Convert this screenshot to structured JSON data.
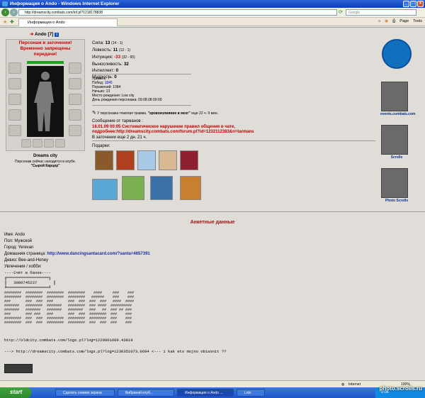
{
  "window": {
    "title": "Информация о Ando - Windows Internet Explorer"
  },
  "browser": {
    "url": "http://dreamscity.combats.com/inf.pl?1218178838",
    "search_placeholder": "Google",
    "tab_label": "Информация о Ando",
    "tools": [
      "Page",
      "Tools"
    ]
  },
  "character": {
    "name": "Ando",
    "level": "[7]",
    "prison_line1": "Персонаж в заточении!",
    "prison_line2": "Временно запрещены",
    "prison_line3": "передачи!",
    "city": "Dreams city",
    "club_text": "Персонаж сейчас находится в клубе.",
    "club_location": "\"Сырой Карцер\""
  },
  "stats": [
    {
      "label": "Сила:",
      "value": "13",
      "extra": "(14 - 1)",
      "neg": false
    },
    {
      "label": "Ловкость:",
      "value": "11",
      "extra": "(12 - 1)",
      "neg": false
    },
    {
      "label": "Интуиция:",
      "value": "-33",
      "extra": "(32 - 65)",
      "neg": true
    },
    {
      "label": "Выносливость:",
      "value": "32",
      "extra": "",
      "neg": false
    },
    {
      "label": "Интеллект:",
      "value": "0",
      "extra": "",
      "neg": false
    },
    {
      "label": "Мудрость:",
      "value": "0",
      "extra": "",
      "neg": false
    }
  ],
  "info": {
    "level_line": "Уровень: 7",
    "wins_label": "Побед: ",
    "wins": "1845",
    "losses": "Поражений: 1084",
    "draws": "Ничьих: 13",
    "birthplace": "Место рождения: Low city",
    "birthday": "День рождения персонажа: 09.08.08 00:00"
  },
  "trauma": {
    "prefix": "У персонажа тяжелая травма. ",
    "name": "\"кровоизлияние в мозг\"",
    "suffix": " еще 22 ч. 9 мин."
  },
  "message": {
    "heading": "Сообщение от тарманов :",
    "line1": "18.01.09 00:05 Систематическое нарушение правил общения в чате,",
    "line2": "подробнее:http://dreamscity.combats.com/forum.pl?id=1232112383&n=tarmans",
    "line3": "В заточении еще 2 дн. 21 ч."
  },
  "gifts": {
    "label": "Подарки:"
  },
  "sidebar": {
    "link1": "events.combats.com",
    "link2": "Scrolls",
    "link3": "Photo Scrolls"
  },
  "anketa": {
    "title": "Анкетные данные",
    "name": "Имя: Ando",
    "sex": "Пол: Мужской",
    "city": "Город: Yerevan",
    "homepage_label": "Домашняя страница: ",
    "homepage": "http://www.dancingsantacard.com/?santa=4657391",
    "motto": "Девиз: Bee-and-Honey",
    "hobby": "Увлечения / хобби:",
    "ascii": "----Счёт в банке----\n╔══════════════════╗\n║   3080745237       ║\n╚══════════════════╝",
    "hashes": "########  ########  ########  ########    ####     ###    ###\n########  ########  ########  ########   ######    ###    ###\n###       ###  ###  ###       ###  ###  ###  ###   ####  ####\n#######   ########  #######   ########  ### ####  ##########\n#######   #######   #######   #######   ###   ##  ### ## ###\n###       ### ###   ###       ###  ###  ########  ###    ###\n########  ###  ###  ########  ########  ########  ###    ###\n########  ###  ###  ########  ########  ###  ###  ###    ###",
    "log1": "http://oldcity.combats.com/logs.pl?log=1229001609.43819",
    "log2": "---> http://dreamscity.combats.com/logs.pl?log=1230351073.0694 <--- i kak eto mojno obiasnit ??"
  },
  "status": {
    "zone": "Internet",
    "zoom": "100%"
  },
  "taskbar": {
    "start": "start",
    "items": [
      "Сделать снимок экрана",
      "Вибраний клуб...",
      "Информация о Ando ...",
      "Lolo"
    ],
    "clock": "0:06"
  },
  "watermark": "photo.scrolls.ru"
}
